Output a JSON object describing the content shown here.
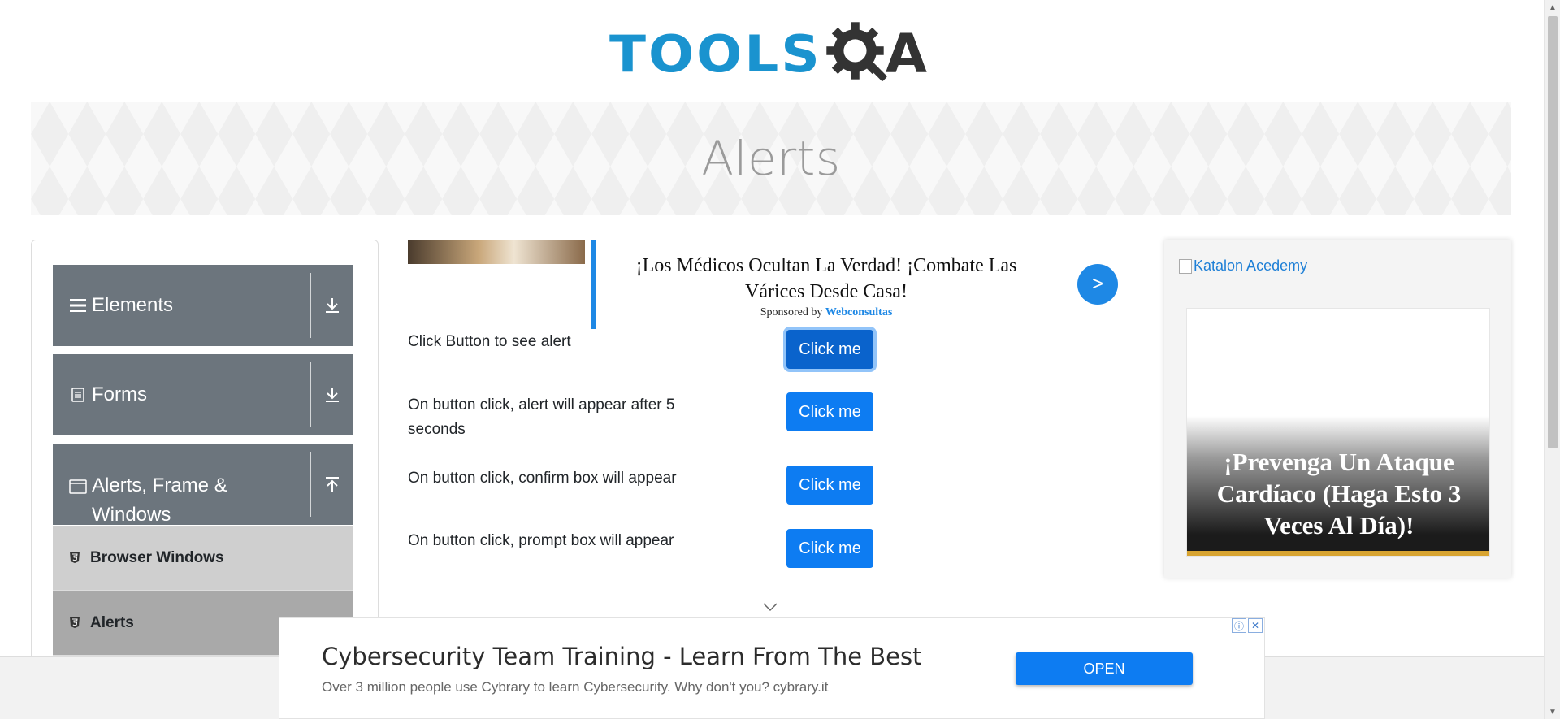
{
  "header": {
    "logo_tools": "TOOLS",
    "logo_qa": "A"
  },
  "banner": {
    "title": "Alerts"
  },
  "sidebar": {
    "groups": [
      {
        "label": "Elements",
        "icon": "hamburger-icon",
        "arrow": "download-icon"
      },
      {
        "label": "Forms",
        "icon": "document-icon",
        "arrow": "download-icon"
      },
      {
        "label": "Alerts, Frame & Windows",
        "icon": "window-icon",
        "arrow": "upload-icon"
      }
    ],
    "items": [
      {
        "label": "Browser Windows",
        "icon": "html5-icon"
      },
      {
        "label": "Alerts",
        "icon": "html5-icon"
      }
    ]
  },
  "ad_top": {
    "headline": "¡Los Médicos Ocultan La Verdad! ¡Combate Las Várices Desde Casa!",
    "sponsored_prefix": "Sponsored by",
    "sponsor": "Webconsultas",
    "go_label": ">"
  },
  "alerts": [
    {
      "label": "Click Button to see alert",
      "button": "Click me"
    },
    {
      "label": "On button click, alert will appear after 5 seconds",
      "button": "Click me"
    },
    {
      "label": "On button click, confirm box will appear",
      "button": "Click me"
    },
    {
      "label": "On button click, prompt box will appear",
      "button": "Click me"
    }
  ],
  "ad_right": {
    "broken_alt": "Katalon Acedemy",
    "headline": "¡Prevenga Un Ataque Cardíaco (Haga Esto 3 Veces Al Día)!"
  },
  "ad_bottom": {
    "title": "Cybersecurity Team Training - Learn From The Best",
    "description": "Over 3 million people use Cybrary to learn Cybersecurity. Why don't you? cybrary.it",
    "open_label": "OPEN",
    "info_icon": "ⓘ",
    "close_icon": "✕"
  },
  "colors": {
    "accent": "#0d7cf2",
    "sidebar_group": "#6c757d",
    "logo_blue": "#1a93cf"
  }
}
